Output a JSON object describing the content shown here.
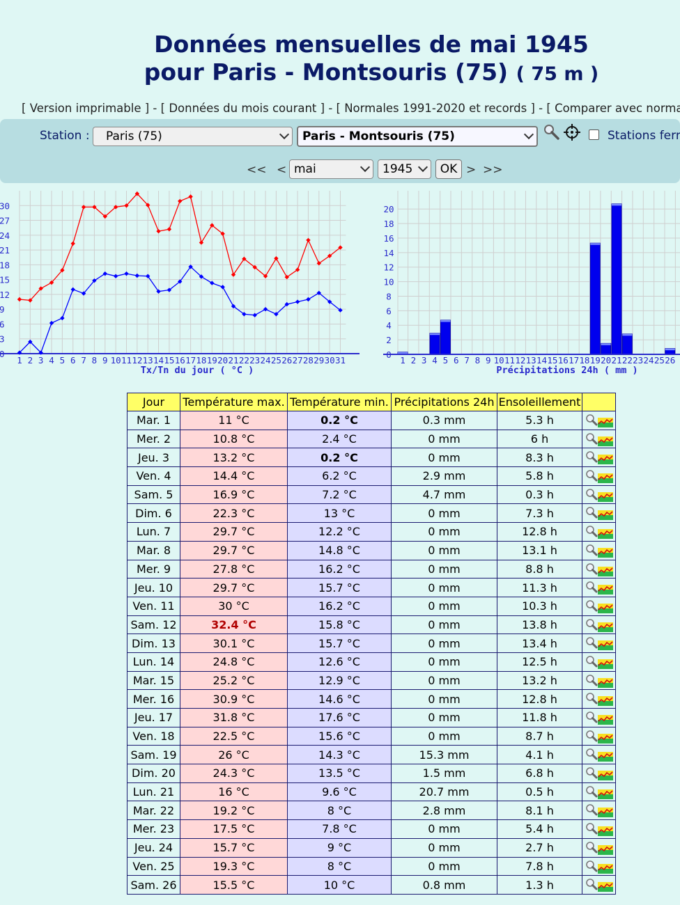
{
  "title": {
    "line1": "Données mensuelles de mai 1945",
    "line2": "pour Paris - Montsouris (75)",
    "altitude": "( 75 m )"
  },
  "links": [
    "Version imprimable",
    "Données du mois courant",
    "Normales 1991-2020 et records",
    "Comparer avec normal"
  ],
  "station_bar": {
    "label": "Station :",
    "department": "Paris (75)",
    "station": "Paris - Montsouris (75)",
    "closed_label": "Stations ferm",
    "nav": {
      "first": "<<",
      "prev": "<",
      "next": ">",
      "last": ">>"
    },
    "month": "mai",
    "year": "1945",
    "ok": "OK"
  },
  "colors": {
    "tmax": "#ff0000",
    "tmin": "#0000ff",
    "bar": "#0000ee",
    "axis": "#2a2acc",
    "grid": "#cfcfcf"
  },
  "chart_data": [
    {
      "type": "line",
      "xlabel": "Tx/Tn du jour ( °C )",
      "x": [
        1,
        2,
        3,
        4,
        5,
        6,
        7,
        8,
        9,
        10,
        11,
        12,
        13,
        14,
        15,
        16,
        17,
        18,
        19,
        20,
        21,
        22,
        23,
        24,
        25,
        26,
        27,
        28,
        29,
        30,
        31
      ],
      "y_ticks": [
        0,
        3,
        6,
        9,
        12,
        15,
        18,
        21,
        24,
        27,
        30
      ],
      "ylim": [
        0,
        33
      ],
      "grid": true,
      "series": [
        {
          "values": [
            11,
            10.8,
            13.2,
            14.4,
            16.9,
            22.3,
            29.7,
            29.7,
            27.8,
            29.7,
            30,
            32.4,
            30.1,
            24.8,
            25.2,
            30.9,
            31.8,
            22.5,
            26,
            24.3,
            16,
            19.2,
            17.5,
            15.7,
            19.3,
            15.5,
            17,
            23,
            18.3,
            19.8,
            21.5
          ]
        },
        {
          "values": [
            0.2,
            2.4,
            0.2,
            6.2,
            7.2,
            13,
            12.2,
            14.8,
            16.2,
            15.7,
            16.2,
            15.8,
            15.7,
            12.6,
            12.9,
            14.6,
            17.6,
            15.6,
            14.3,
            13.5,
            9.6,
            8,
            7.8,
            9,
            8,
            10,
            10.5,
            11,
            12.3,
            10.5,
            8.8
          ]
        }
      ]
    },
    {
      "type": "bar",
      "xlabel": "Précipitations 24h ( mm )",
      "x": [
        1,
        2,
        3,
        4,
        5,
        6,
        7,
        8,
        9,
        10,
        11,
        12,
        13,
        14,
        15,
        16,
        17,
        18,
        19,
        20,
        21,
        22,
        23,
        24,
        25,
        26
      ],
      "values": [
        0.3,
        0,
        0,
        2.9,
        4.7,
        0,
        0,
        0,
        0,
        0,
        0,
        0,
        0,
        0,
        0,
        0,
        0,
        0,
        15.3,
        1.5,
        20.7,
        2.8,
        0,
        0,
        0,
        0.8
      ],
      "y_ticks": [
        0,
        2,
        4,
        6,
        8,
        10,
        12,
        14,
        16,
        18,
        20
      ],
      "ylim": [
        0,
        22
      ],
      "grid": true
    }
  ],
  "table": {
    "headers": [
      "Jour",
      "Température max.",
      "Température min.",
      "Précipitations 24h",
      "Ensoleillement",
      ""
    ],
    "rows": [
      {
        "day": "Mar. 1",
        "tmax": "11 °C",
        "tmin": "0.2 °C",
        "precip": "0.3 mm",
        "sun": "5.3 h"
      },
      {
        "day": "Mer. 2",
        "tmax": "10.8 °C",
        "tmin": "2.4 °C",
        "precip": "0 mm",
        "sun": "6 h"
      },
      {
        "day": "Jeu. 3",
        "tmax": "13.2 °C",
        "tmin": "0.2 °C",
        "precip": "0 mm",
        "sun": "8.3 h"
      },
      {
        "day": "Ven. 4",
        "tmax": "14.4 °C",
        "tmin": "6.2 °C",
        "precip": "2.9 mm",
        "sun": "5.8 h"
      },
      {
        "day": "Sam. 5",
        "tmax": "16.9 °C",
        "tmin": "7.2 °C",
        "precip": "4.7 mm",
        "sun": "0.3 h"
      },
      {
        "day": "Dim. 6",
        "tmax": "22.3 °C",
        "tmin": "13 °C",
        "precip": "0 mm",
        "sun": "7.3 h"
      },
      {
        "day": "Lun. 7",
        "tmax": "29.7 °C",
        "tmin": "12.2 °C",
        "precip": "0 mm",
        "sun": "12.8 h"
      },
      {
        "day": "Mar. 8",
        "tmax": "29.7 °C",
        "tmin": "14.8 °C",
        "precip": "0 mm",
        "sun": "13.1 h"
      },
      {
        "day": "Mer. 9",
        "tmax": "27.8 °C",
        "tmin": "16.2 °C",
        "precip": "0 mm",
        "sun": "8.8 h"
      },
      {
        "day": "Jeu. 10",
        "tmax": "29.7 °C",
        "tmin": "15.7 °C",
        "precip": "0 mm",
        "sun": "11.3 h"
      },
      {
        "day": "Ven. 11",
        "tmax": "30 °C",
        "tmin": "16.2 °C",
        "precip": "0 mm",
        "sun": "10.3 h"
      },
      {
        "day": "Sam. 12",
        "tmax": "32.4 °C",
        "tmin": "15.8 °C",
        "precip": "0 mm",
        "sun": "13.8 h"
      },
      {
        "day": "Dim. 13",
        "tmax": "30.1 °C",
        "tmin": "15.7 °C",
        "precip": "0 mm",
        "sun": "13.4 h"
      },
      {
        "day": "Lun. 14",
        "tmax": "24.8 °C",
        "tmin": "12.6 °C",
        "precip": "0 mm",
        "sun": "12.5 h"
      },
      {
        "day": "Mar. 15",
        "tmax": "25.2 °C",
        "tmin": "12.9 °C",
        "precip": "0 mm",
        "sun": "13.2 h"
      },
      {
        "day": "Mer. 16",
        "tmax": "30.9 °C",
        "tmin": "14.6 °C",
        "precip": "0 mm",
        "sun": "12.8 h"
      },
      {
        "day": "Jeu. 17",
        "tmax": "31.8 °C",
        "tmin": "17.6 °C",
        "precip": "0 mm",
        "sun": "11.8 h"
      },
      {
        "day": "Ven. 18",
        "tmax": "22.5 °C",
        "tmin": "15.6 °C",
        "precip": "0 mm",
        "sun": "8.7 h"
      },
      {
        "day": "Sam. 19",
        "tmax": "26 °C",
        "tmin": "14.3 °C",
        "precip": "15.3 mm",
        "sun": "4.1 h"
      },
      {
        "day": "Dim. 20",
        "tmax": "24.3 °C",
        "tmin": "13.5 °C",
        "precip": "1.5 mm",
        "sun": "6.8 h"
      },
      {
        "day": "Lun. 21",
        "tmax": "16 °C",
        "tmin": "9.6 °C",
        "precip": "20.7 mm",
        "sun": "0.5 h"
      },
      {
        "day": "Mar. 22",
        "tmax": "19.2 °C",
        "tmin": "8 °C",
        "precip": "2.8 mm",
        "sun": "8.1 h"
      },
      {
        "day": "Mer. 23",
        "tmax": "17.5 °C",
        "tmin": "7.8 °C",
        "precip": "0 mm",
        "sun": "5.4 h"
      },
      {
        "day": "Jeu. 24",
        "tmax": "15.7 °C",
        "tmin": "9 °C",
        "precip": "0 mm",
        "sun": "2.7 h"
      },
      {
        "day": "Ven. 25",
        "tmax": "19.3 °C",
        "tmin": "8 °C",
        "precip": "0 mm",
        "sun": "7.8 h"
      },
      {
        "day": "Sam. 26",
        "tmax": "15.5 °C",
        "tmin": "10 °C",
        "precip": "0.8 mm",
        "sun": "1.3 h"
      }
    ],
    "max_record_day": "Sam. 12",
    "min_record_days": [
      "Mar. 1",
      "Jeu. 3"
    ],
    "row_icons": [
      "magnifier-icon",
      "mini-chart-icon"
    ]
  }
}
